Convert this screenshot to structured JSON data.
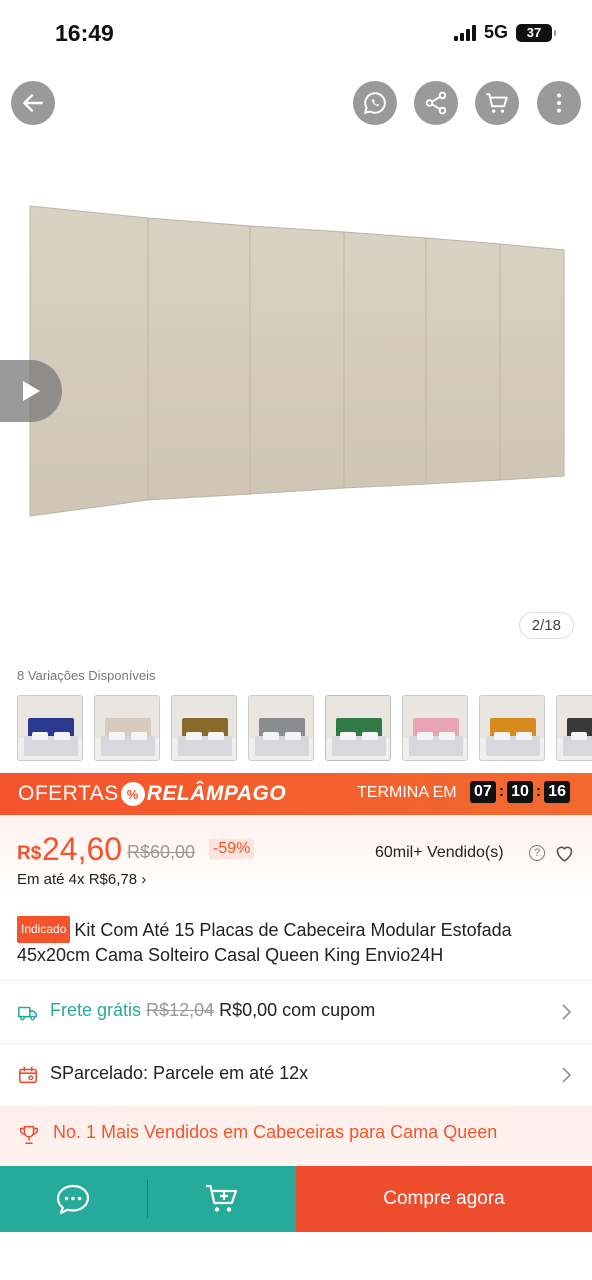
{
  "status_bar": {
    "time": "16:49",
    "network": "5G",
    "battery": "37"
  },
  "nav": {
    "back_icon": "arrow-left-icon",
    "whatsapp_icon": "whatsapp-icon",
    "share_icon": "share-icon",
    "cart_icon": "cart-icon",
    "more_icon": "more-vertical-icon"
  },
  "gallery": {
    "page_indicator": "2/18",
    "play_icon": "play-icon"
  },
  "variants": {
    "label": "8 Variações Disponíveis",
    "colors": [
      "#2b3a8f",
      "#d8cbbd",
      "#8a6a2a",
      "#8a8c90",
      "#2f7a45",
      "#e8a3b5",
      "#d98a1c",
      "#3a3a3a"
    ]
  },
  "flash_sale": {
    "title_part1": "OFERTAS",
    "icon_symbol": "%",
    "title_part2": "RELÂMPAGO",
    "ends_label": "TERMINA EM",
    "hours": "07",
    "minutes": "10",
    "seconds": "16",
    "separator": ":"
  },
  "price": {
    "currency": "R$",
    "current": "24,60",
    "original": "R$60,00",
    "discount": "-59%",
    "sold": "60mil+ Vendido(s)",
    "help_symbol": "?",
    "installments": "Em até 4x R$6,78 ›"
  },
  "product": {
    "badge": "Indicado",
    "title": "Kit Com Até 15 Placas de Cabeceira Modular Estofada 45x20cm Cama Solteiro Casal Queen King Envio24H"
  },
  "shipping": {
    "free_label": "Frete grátis",
    "old_price": "R$12,04",
    "new_price": "R$0,00 com cupom"
  },
  "installment_row": {
    "label": "SParcelado: Parcele em até 12x"
  },
  "ranking": {
    "label": "No. 1 Mais Vendidos em Cabeceiras para Cama Queen"
  },
  "bottom_bar": {
    "buy_label": "Compre agora"
  },
  "colors": {
    "accent": "#ee4d2d",
    "teal": "#26aa99"
  }
}
